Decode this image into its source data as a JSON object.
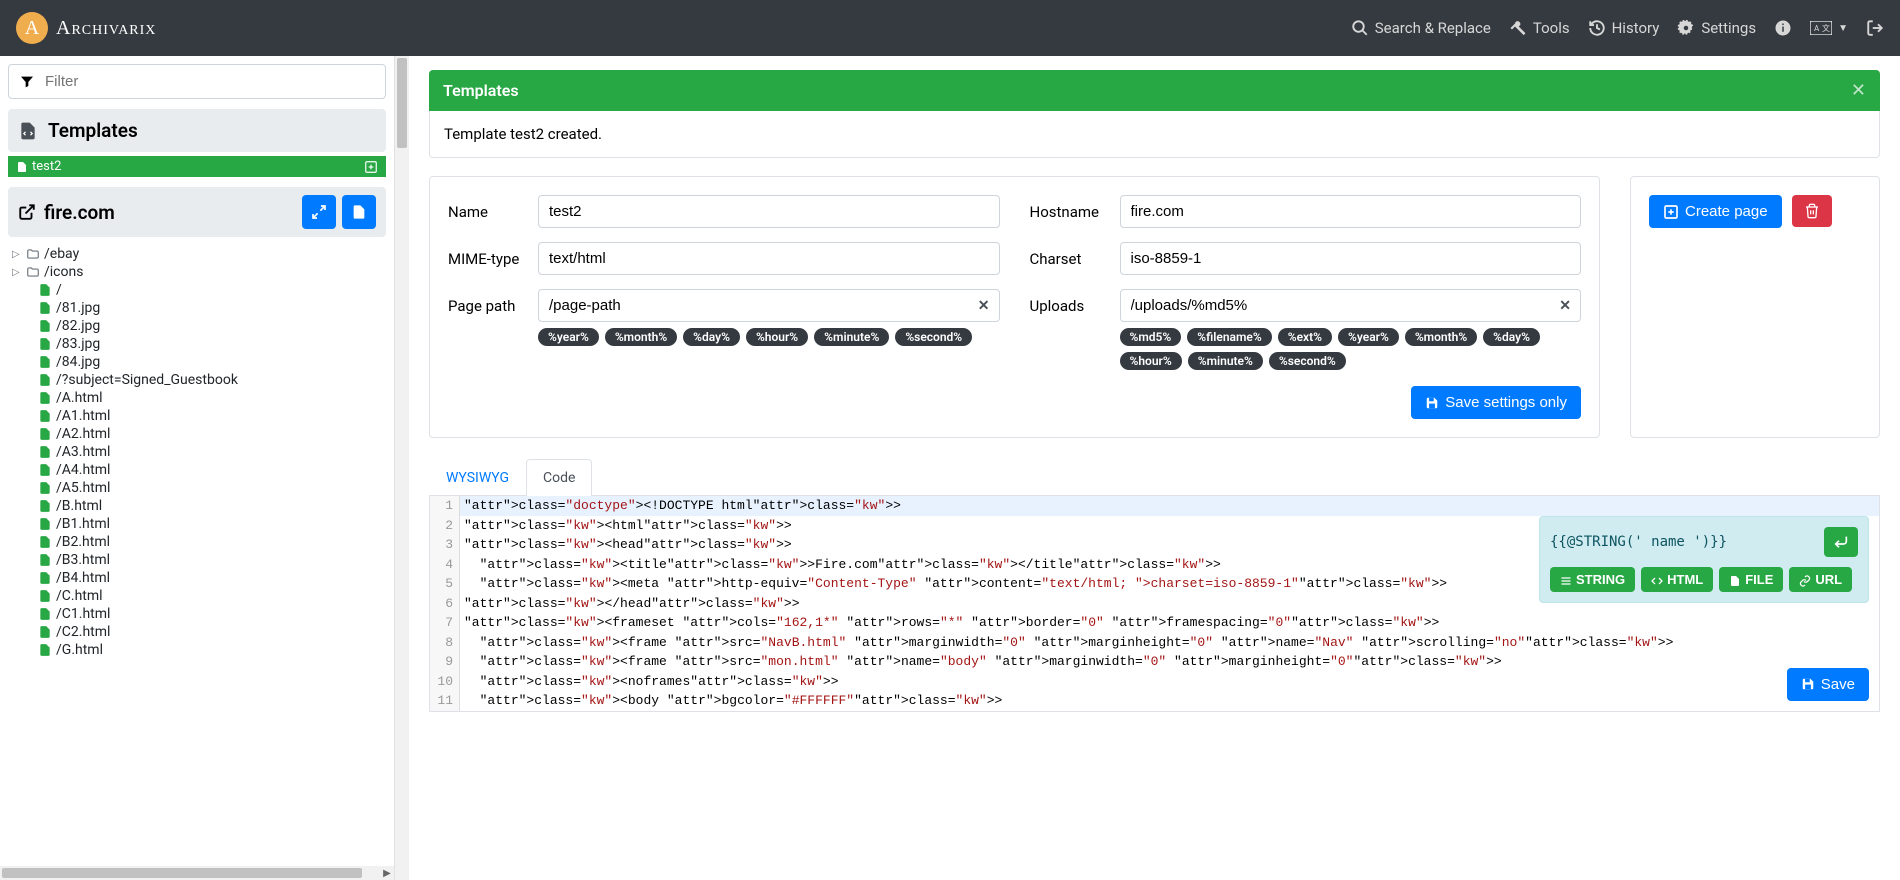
{
  "brand": "Archivarix",
  "nav": {
    "search": "Search & Replace",
    "tools": "Tools",
    "history": "History",
    "settings": "Settings"
  },
  "sidebar": {
    "filter_placeholder": "Filter",
    "templates_header": "Templates",
    "template_item": "test2",
    "domain": "fire.com",
    "folders": [
      {
        "name": "/ebay"
      },
      {
        "name": "/icons"
      }
    ],
    "files": [
      "/",
      "/81.jpg",
      "/82.jpg",
      "/83.jpg",
      "/84.jpg",
      "/?subject=Signed_Guestbook",
      "/A.html",
      "/A1.html",
      "/A2.html",
      "/A3.html",
      "/A4.html",
      "/A5.html",
      "/B.html",
      "/B1.html",
      "/B2.html",
      "/B3.html",
      "/B4.html",
      "/C.html",
      "/C1.html",
      "/C2.html",
      "/G.html"
    ]
  },
  "alert": {
    "title": "Templates",
    "body": "Template test2 created."
  },
  "form": {
    "name_label": "Name",
    "name_value": "test2",
    "mime_label": "MIME-type",
    "mime_value": "text/html",
    "page_path_label": "Page path",
    "page_path_value": "/page-path",
    "page_tags": [
      "%year%",
      "%month%",
      "%day%",
      "%hour%",
      "%minute%",
      "%second%"
    ],
    "hostname_label": "Hostname",
    "hostname_value": "fire.com",
    "charset_label": "Charset",
    "charset_value": "iso-8859-1",
    "uploads_label": "Uploads",
    "uploads_value": "/uploads/%md5%",
    "uploads_tags": [
      "%md5%",
      "%filename%",
      "%ext%",
      "%year%",
      "%month%",
      "%day%",
      "%hour%",
      "%minute%",
      "%second%"
    ],
    "save_settings": "Save settings only"
  },
  "actions": {
    "create_page": "Create page",
    "save": "Save"
  },
  "tabs": {
    "wysiwyg": "WYSIWYG",
    "code": "Code"
  },
  "code": {
    "lines": [
      "<!DOCTYPE html>",
      "<html>",
      "<head>",
      "  <title>Fire.com</title>",
      "  <meta http-equiv=\"Content-Type\" content=\"text/html; charset=iso-8859-1\">",
      "</head>",
      "<frameset cols=\"162,1*\" rows=\"*\" border=\"0\" framespacing=\"0\">",
      "  <frame src=\"NavB.html\" marginwidth=\"0\" marginheight=\"0\" name=\"Nav\" scrolling=\"no\">",
      "  <frame src=\"mon.html\" name=\"body\" marginwidth=\"0\" marginheight=\"0\">",
      "  <noframes>",
      "  <body bgcolor=\"#FFFFFF\">"
    ]
  },
  "insert": {
    "expr": "{{@STRING(' name ')}}",
    "btns": [
      "STRING",
      "HTML",
      "FILE",
      "URL"
    ]
  }
}
